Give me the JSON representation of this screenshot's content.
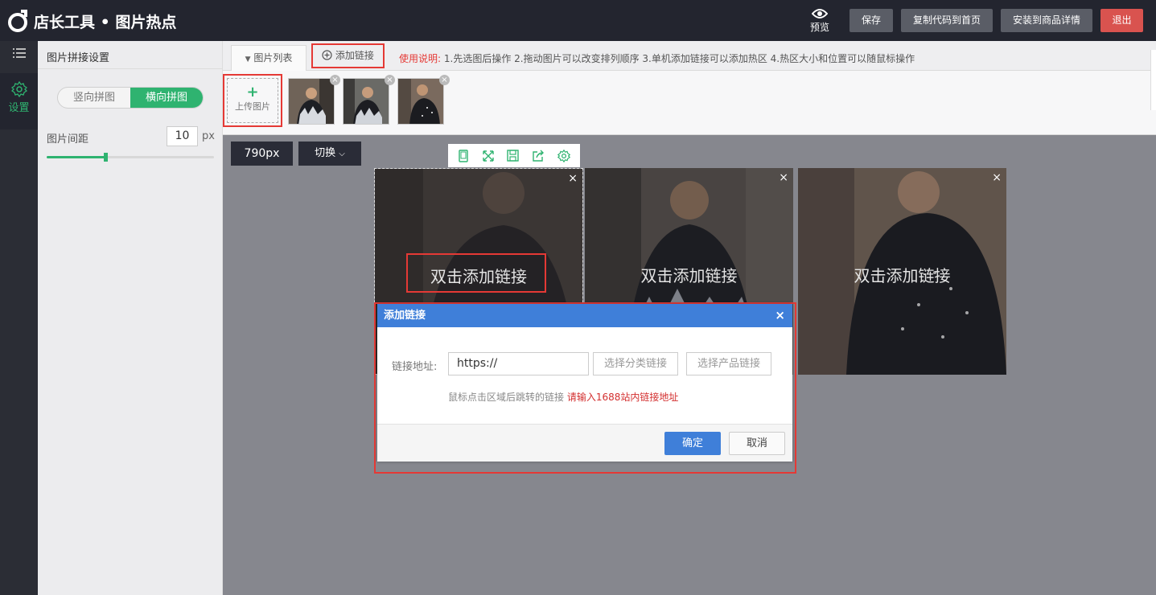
{
  "app": {
    "logo_text": "店长工具 • 图片热点"
  },
  "topbar": {
    "preview_label": "预览",
    "save_label": "保存",
    "copy_label": "复制代码到首页",
    "install_label": "安装到商品详情",
    "exit_label": "退出"
  },
  "rail": {
    "settings_label": "设置"
  },
  "panel": {
    "title": "图片拼接设置",
    "vertical_label": "竖向拼图",
    "horizontal_label": "横向拼图",
    "gap_label": "图片间距",
    "gap_value": "10",
    "gap_unit": "px",
    "gap_slider_fraction": 0.35
  },
  "tabs": {
    "image_list_label": "图片列表",
    "add_link_label": "添加链接",
    "usage_prefix": "使用说明:",
    "usage_text": "1.先选图后操作 2.拖动图片可以改变排列顺序 3.单机添加链接可以添加热区 4.热区大小和位置可以随鼠标操作"
  },
  "strip": {
    "upload_label": "上传图片",
    "upload_plus": "+",
    "remove_mark": "×"
  },
  "canvas": {
    "size_label": "790px",
    "switch_label": "切换",
    "hotspot_text": "双击添加链接",
    "close_mark": "×"
  },
  "dialog": {
    "title": "添加链接",
    "close_mark": "×",
    "url_label": "链接地址:",
    "url_value": "https://",
    "category_link_label": "选择分类链接",
    "product_link_label": "选择产品链接",
    "hint_text": "鼠标点击区域后跳转的链接",
    "hint_red": "请输入1688站内链接地址",
    "ok_label": "确定",
    "cancel_label": "取消"
  },
  "colors": {
    "accent_green": "#2fb370",
    "highlight_red": "#e53935",
    "dialog_blue": "#3f7fd9",
    "topbar_dark": "#23252f"
  }
}
